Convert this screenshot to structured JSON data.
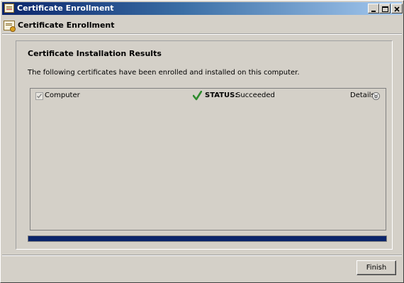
{
  "window": {
    "title": "Certificate Enrollment"
  },
  "header": {
    "title": "Certificate Enrollment",
    "icon": "certificate-icon"
  },
  "results": {
    "title": "Certificate Installation Results",
    "description": "The following certificates have been enrolled and installed on this computer.",
    "items": [
      {
        "label": "Computer",
        "checked": true,
        "status_label": "STATUS:",
        "status_value": "Succeeded",
        "status_icon": "checkmark-icon",
        "details_label": "Details"
      }
    ]
  },
  "progress": {
    "value_percent": 100
  },
  "footer": {
    "finish_label": "Finish"
  },
  "colors": {
    "progress_fill": "#0a246a",
    "success_check": "#2e8b2e",
    "titlebar_start": "#0a246a",
    "titlebar_end": "#a6caf0"
  }
}
